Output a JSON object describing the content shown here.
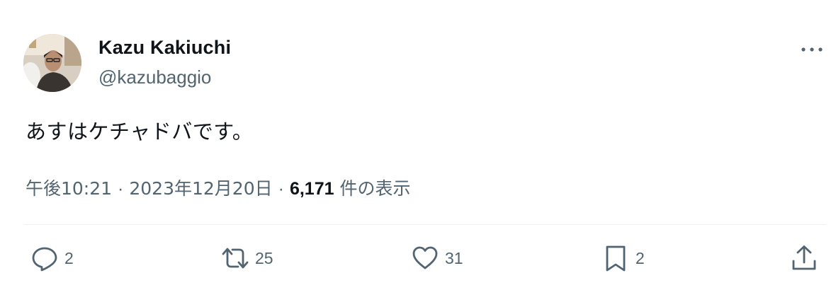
{
  "author": {
    "display_name": "Kazu Kakiuchi",
    "handle": "@kazubaggio"
  },
  "tweet": {
    "text": "あすはケチャドバです。"
  },
  "meta": {
    "time": "午後10:21",
    "separator": "·",
    "date": "2023年12月20日",
    "views_count": "6,171",
    "views_label": "件の表示"
  },
  "actions": {
    "reply_count": "2",
    "retweet_count": "25",
    "like_count": "31",
    "bookmark_count": "2"
  },
  "icons": {
    "more": "more-horizontal-icon",
    "reply": "reply-icon",
    "retweet": "retweet-icon",
    "like": "heart-icon",
    "bookmark": "bookmark-icon",
    "share": "share-icon"
  },
  "colors": {
    "text_primary": "#0f1419",
    "text_secondary": "#536471",
    "divider": "#eff3f4"
  }
}
